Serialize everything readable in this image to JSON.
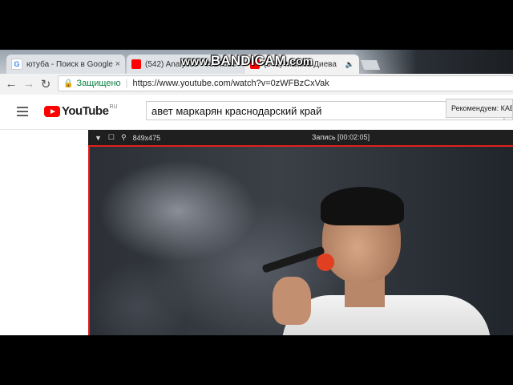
{
  "tabs": [
    {
      "label": "ютуба - Поиск в Google",
      "close": "×",
      "favicon": "google-icon",
      "color": "#4285f4"
    },
    {
      "label": "(542) Analytics - YouTube",
      "close": "×",
      "favicon": "youtube-icon",
      "color": "#ff0000"
    },
    {
      "label": "(542) Мамма Диева",
      "close": "",
      "favicon": "youtube-icon",
      "color": "#ff0000"
    }
  ],
  "toolbar": {
    "back": "←",
    "forward": "→",
    "reload": "↻",
    "secure_label": "Защищено",
    "url": "https://www.youtube.com/watch?v=0zWFBzCxVak"
  },
  "youtube": {
    "logo_text": "YouTube",
    "region": "RU",
    "search_value": "авет маркарян краснодарский край"
  },
  "recorder": {
    "size": "849x475",
    "status": "Запись [00:02:05]"
  },
  "tooltip": "Рекомендуем: КАВКАЗ",
  "watermark": {
    "prefix": "www.",
    "brand": "BANDICAM",
    "suffix": ".com"
  }
}
